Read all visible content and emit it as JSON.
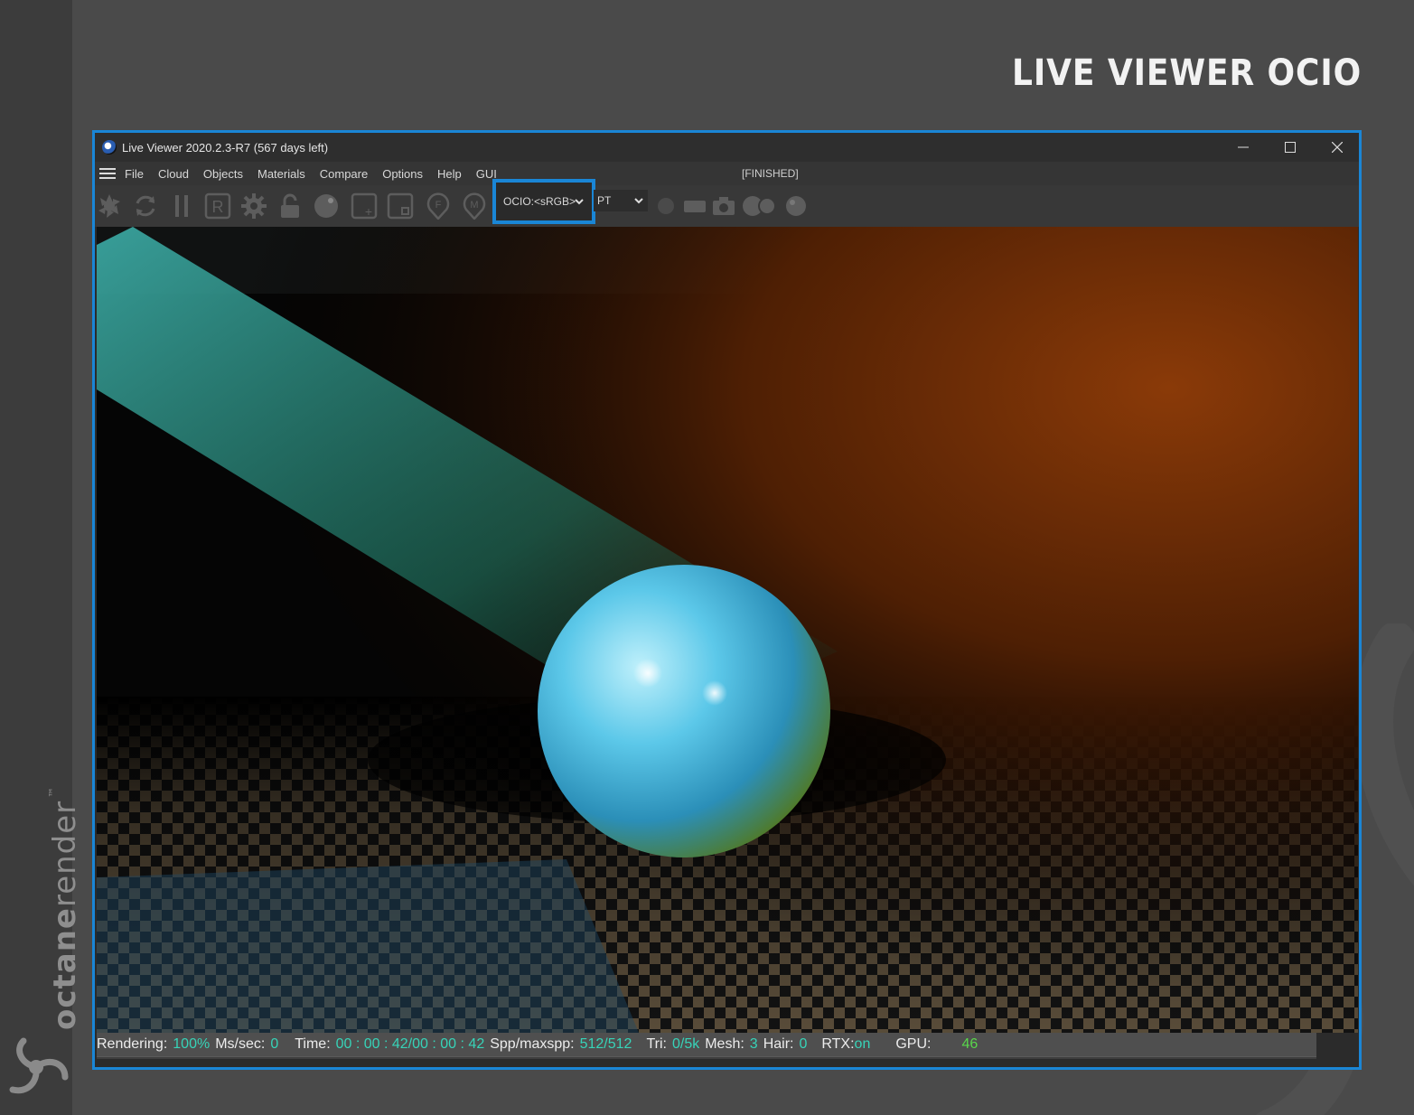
{
  "page": {
    "title": "LIVE VIEWER OCIO"
  },
  "brand": {
    "word_light": "octane",
    "word_bold": "render",
    "trademark": "™"
  },
  "window": {
    "title": "Live Viewer 2020.2.3-R7 (567 days left)",
    "controls": {
      "minimize": "—",
      "maximize": "☐",
      "close": "✕"
    }
  },
  "menu": {
    "items": [
      "File",
      "Cloud",
      "Objects",
      "Materials",
      "Compare",
      "Options",
      "Help",
      "GUI"
    ],
    "status": "[FINISHED]"
  },
  "toolbar": {
    "ocio": "OCIO:<sRGB>",
    "kernel": "PT",
    "icons": [
      "aperture-icon",
      "refresh-icon",
      "pause-icon",
      "r-box-icon",
      "gear-icon",
      "unlock-icon",
      "sphere-icon",
      "add-region-icon",
      "focus-region-icon",
      "f-pin-icon",
      "m-pin-icon"
    ],
    "right_icons": [
      "dot-icon",
      "filmstrip-icon",
      "camera-icon",
      "balls-icon",
      "ball-icon"
    ]
  },
  "status": {
    "rendering_label": "Rendering:",
    "rendering_value": "100%",
    "mssec_label": "Ms/sec:",
    "mssec_value": "0",
    "time_label": "Time:",
    "time_value": "00 : 00 : 42/00 : 00 : 42",
    "spp_label": "Spp/maxspp:",
    "spp_value": "512/512",
    "tri_label": "Tri:",
    "tri_value": "0/5k",
    "mesh_label": "Mesh:",
    "mesh_value": "3",
    "hair_label": "Hair:",
    "hair_value": "0",
    "rtx_label": "RTX:",
    "rtx_value": "on",
    "gpu_label": "GPU:",
    "gpu_value": "46"
  },
  "colors": {
    "accent": "#1a86d6",
    "status_value": "#37d3b8",
    "gpu_value": "#59d64b"
  }
}
